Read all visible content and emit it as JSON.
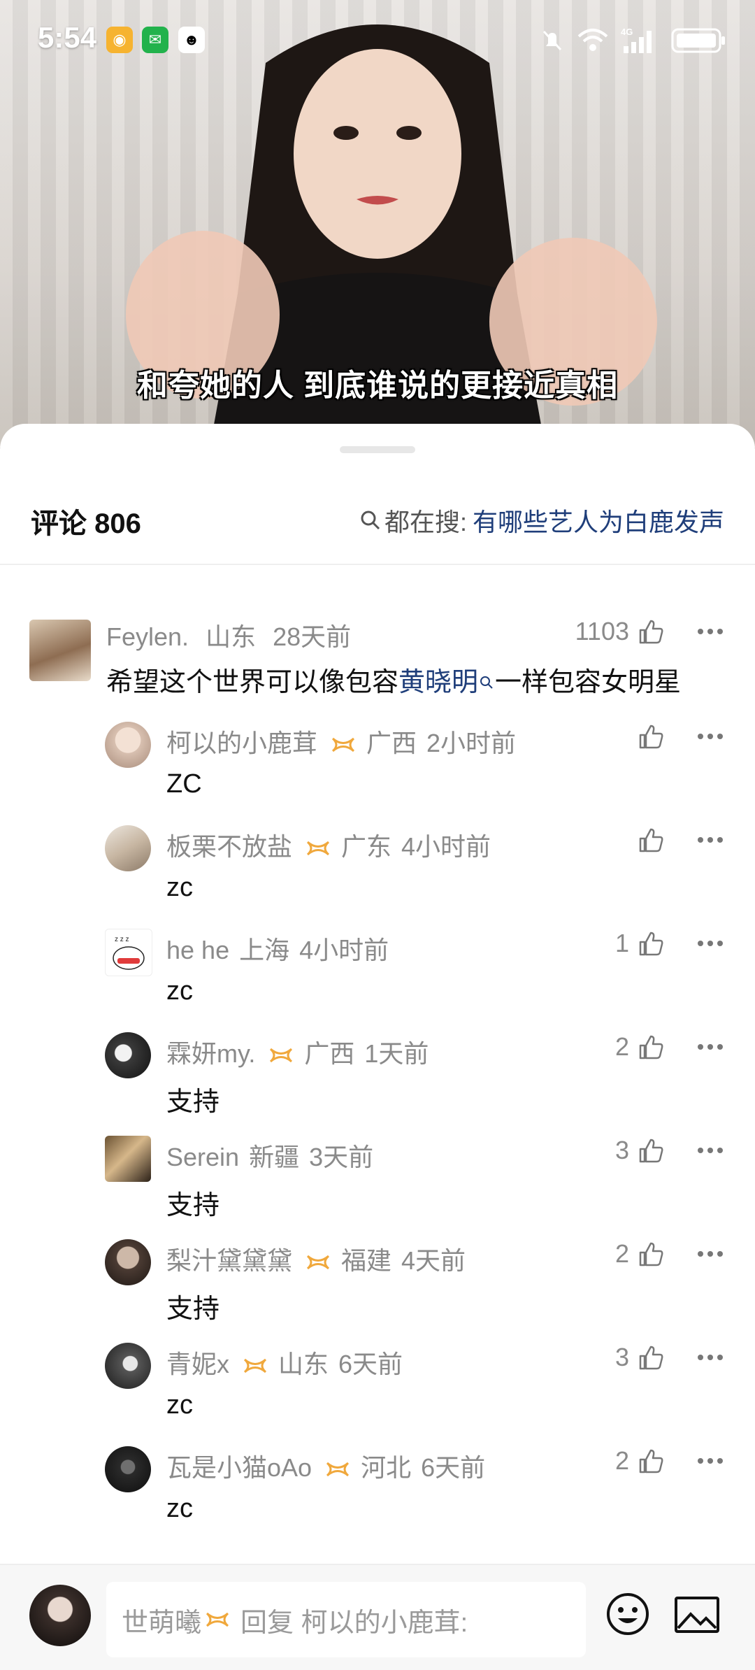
{
  "status_bar": {
    "time": "5:54",
    "apps": [
      "weibo-icon",
      "wechat-icon",
      "qq-icon"
    ],
    "network": "4G"
  },
  "video": {
    "subtitle": "和夸她的人 到底谁说的更接近真相"
  },
  "comments_header": {
    "title": "评论 806",
    "search_label": "都在搜:",
    "search_term": "有哪些艺人为白鹿发声"
  },
  "main_comment": {
    "user": "Feylen.",
    "location": "山东",
    "time": "28天前",
    "likes": "1103",
    "text_before": "希望这个世界可以像包容",
    "text_link": "黄晓明",
    "text_after": "一样包容女明星"
  },
  "replies": [
    {
      "user": "柯以的小鹿茸",
      "badge": true,
      "location": "广西",
      "time": "2小时前",
      "likes": "",
      "text": "ZC"
    },
    {
      "user": "板栗不放盐",
      "badge": true,
      "location": "广东",
      "time": "4小时前",
      "likes": "",
      "text": "zc"
    },
    {
      "user": "he he",
      "badge": false,
      "location": "上海",
      "time": "4小时前",
      "likes": "1",
      "text": "zc"
    },
    {
      "user": "霖妍my.",
      "badge": true,
      "location": "广西",
      "time": "1天前",
      "likes": "2",
      "text": "支持"
    },
    {
      "user": "Serein",
      "badge": false,
      "location": "新疆",
      "time": "3天前",
      "likes": "3",
      "text": "支持"
    },
    {
      "user": "梨汁黛黛黛",
      "badge": true,
      "location": "福建",
      "time": "4天前",
      "likes": "2",
      "text": "支持"
    },
    {
      "user": "青妮x",
      "badge": true,
      "location": "山东",
      "time": "6天前",
      "likes": "3",
      "text": "zc"
    },
    {
      "user": "瓦是小猫oAo",
      "badge": true,
      "location": "河北",
      "time": "6天前",
      "likes": "2",
      "text": "zc"
    }
  ],
  "reply_bar": {
    "user": "世萌曦",
    "prompt": "回复 柯以的小鹿茸:"
  },
  "colors": {
    "link": "#1f3e7a",
    "meta": "#8a8a8a",
    "badge": "#f0a83c"
  }
}
